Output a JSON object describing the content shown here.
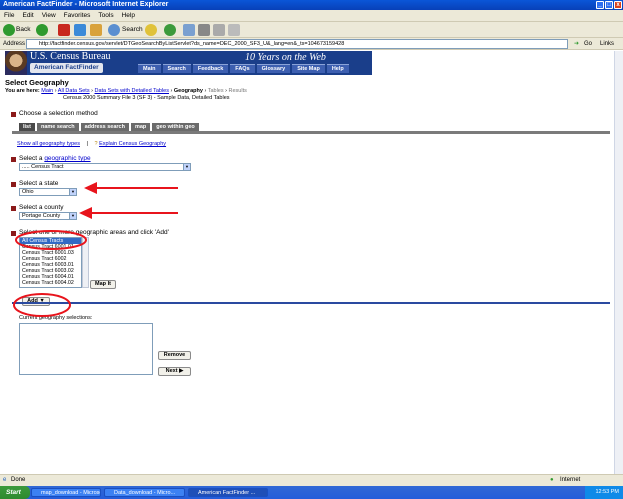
{
  "window": {
    "title": "American FactFinder - Microsoft Internet Explorer"
  },
  "menu": [
    "File",
    "Edit",
    "View",
    "Favorites",
    "Tools",
    "Help"
  ],
  "toolbar": {
    "back_label": "Back",
    "search_label": "Search",
    "favorites_label": "Favorites"
  },
  "address": {
    "label": "Address",
    "url": "http://factfinder.census.gov/servlet/DTGeoSearchByListServlet?ds_name=DEC_2000_SF3_U&_lang=en&_ts=104673159428",
    "go_label": "Go",
    "links_label": "Links"
  },
  "banner": {
    "bureau": "U.S. Census Bureau",
    "aff": "American FactFinder",
    "tagline": "10 Years on the Web",
    "nav": [
      "Main",
      "Search",
      "Feedback",
      "FAQs",
      "Glossary",
      "Site Map",
      "Help"
    ]
  },
  "page": {
    "title": "Select Geography",
    "you_are_here": "You are here:",
    "crumb_main": "Main",
    "crumb_all": "All Data Sets",
    "crumb_detail": "Data Sets with Detailed Tables",
    "crumb_geo": "Geography",
    "crumb_tables": "Tables",
    "crumb_results": "Results",
    "dataset": "Census 2000 Summary File 3 (SF 3) - Sample Data, Detailed Tables"
  },
  "method": {
    "label": "Choose a selection method",
    "tabs": [
      "list",
      "name search",
      "address search",
      "map",
      "geo within geo"
    ]
  },
  "links": {
    "show_all": "Show all geography types",
    "sep": "|",
    "explain": "Explain Census Geography"
  },
  "geo_type": {
    "label_pre": "Select a",
    "label_link": "geographic type",
    "value": "..... Census Tract"
  },
  "state": {
    "label": "Select a state",
    "value": "Ohio"
  },
  "county": {
    "label": "Select a county",
    "value": "Portage County"
  },
  "areas": {
    "label": "Select one or more geographic areas and click 'Add'",
    "items": [
      "All Census Tracts",
      "Census Tract 6001.01",
      "Census Tract 6001.03",
      "Census Tract 6002",
      "Census Tract 6003.01",
      "Census Tract 6003.02",
      "Census Tract 6004.01",
      "Census Tract 6004.02"
    ],
    "map_it": "Map It"
  },
  "add_button": "Add",
  "current": {
    "label": "Current geography selections:",
    "remove": "Remove",
    "next": "Next"
  },
  "status": {
    "text": "Done",
    "zone": "Internet"
  },
  "taskbar": {
    "start": "Start",
    "tasks": [
      "map_download - Microso...",
      "Data_download - Micro...",
      "American FactFinder ..."
    ],
    "clock": "12:53 PM"
  },
  "colors": {
    "annotation": "#e8141c",
    "brand": "#1a3e8a"
  }
}
